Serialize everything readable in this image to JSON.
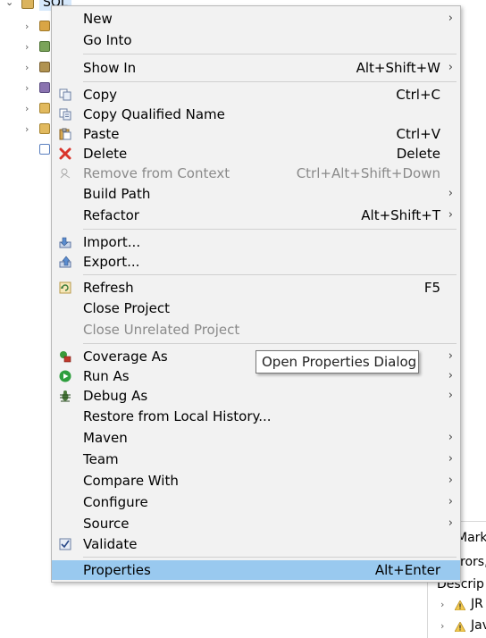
{
  "tree": {
    "root_label": "SQL",
    "rows": [
      {
        "icon": "package-folder-icon",
        "color": "#d9a545"
      },
      {
        "icon": "library-icon",
        "color": "#7aa35a"
      },
      {
        "icon": "jar-library-icon",
        "color": "#b09250"
      },
      {
        "icon": "jar-library-icon",
        "color": "#8a73b0"
      },
      {
        "icon": "folder-icon",
        "color": "#e1b95e"
      },
      {
        "icon": "folder-icon",
        "color": "#e1b95e"
      },
      {
        "icon": "maven-pom-icon",
        "color": "#5a7fbf"
      }
    ]
  },
  "background_panel": {
    "line1": "Marke",
    "line2": "rors,",
    "line3": "Descrip",
    "line4": "JR",
    "line5": "Jav"
  },
  "menu": {
    "new": "New",
    "go_into": "Go Into",
    "show_in": "Show In",
    "show_in_acc": "Alt+Shift+W",
    "copy": "Copy",
    "copy_acc": "Ctrl+C",
    "copy_qualified": "Copy Qualified Name",
    "paste": "Paste",
    "paste_acc": "Ctrl+V",
    "delete": "Delete",
    "delete_acc": "Delete",
    "remove_context": "Remove from Context",
    "remove_context_acc": "Ctrl+Alt+Shift+Down",
    "build_path": "Build Path",
    "refactor": "Refactor",
    "refactor_acc": "Alt+Shift+T",
    "import": "Import...",
    "export": "Export...",
    "refresh": "Refresh",
    "refresh_acc": "F5",
    "close_project": "Close Project",
    "close_unrelated": "Close Unrelated Project",
    "coverage_as": "Coverage As",
    "run_as": "Run As",
    "debug_as": "Debug As",
    "restore_history": "Restore from Local History...",
    "maven": "Maven",
    "team": "Team",
    "compare_with": "Compare With",
    "configure": "Configure",
    "source": "Source",
    "validate": "Validate",
    "properties": "Properties",
    "properties_acc": "Alt+Enter",
    "arrow_glyph": "›"
  },
  "tooltip": {
    "text": "Open Properties Dialog"
  }
}
